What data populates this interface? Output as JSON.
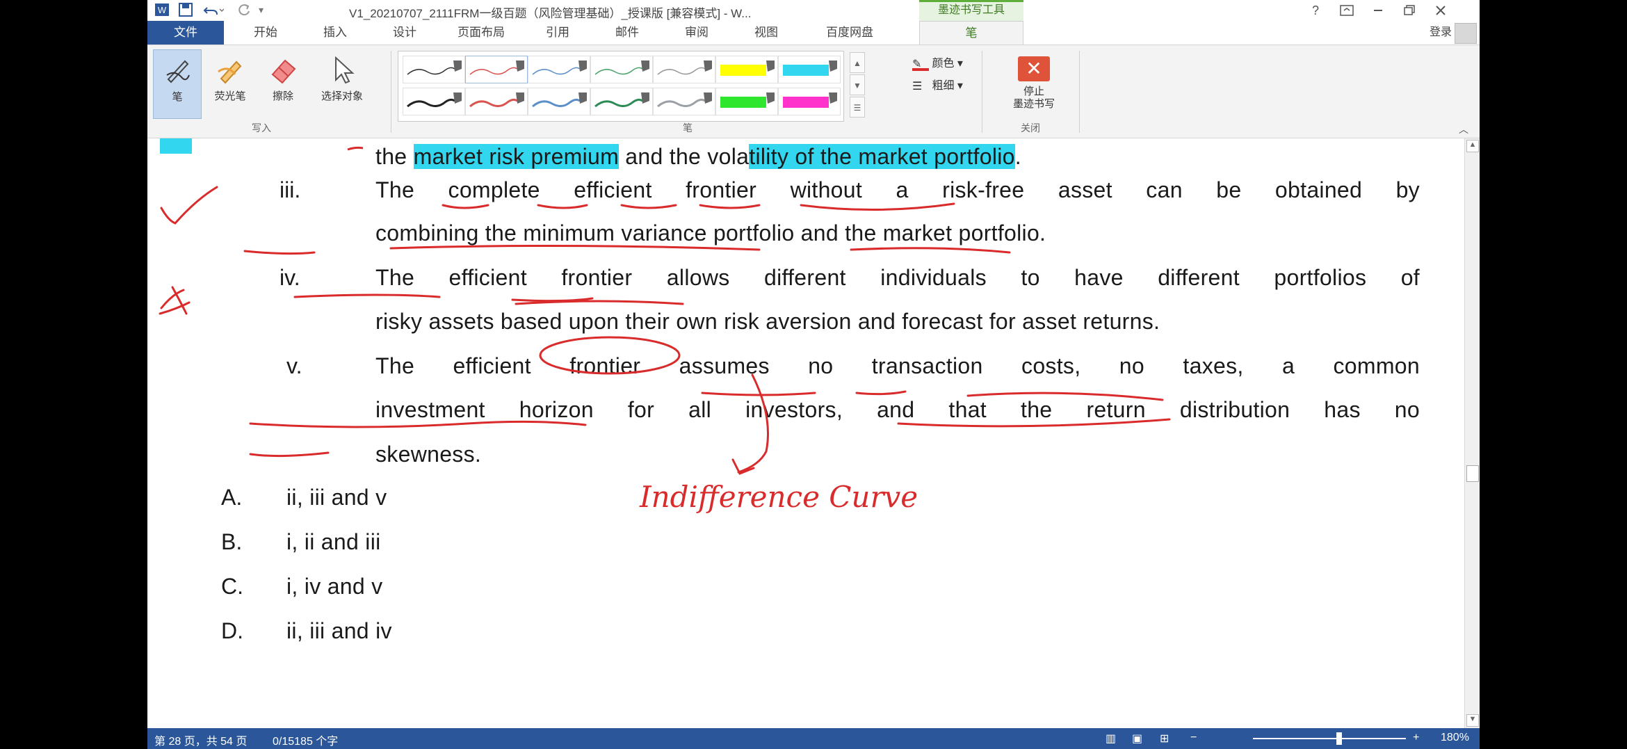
{
  "window": {
    "title": "V1_20210707_2111FRM一级百题（风险管理基础）_授课版 [兼容模式] - W...",
    "context_tab": "墨迹书写工具",
    "help": "?",
    "login": "登录"
  },
  "tabs": [
    "文件",
    "开始",
    "插入",
    "设计",
    "页面布局",
    "引用",
    "邮件",
    "审阅",
    "视图",
    "百度网盘",
    "笔"
  ],
  "ribbon": {
    "write_group": {
      "buttons": [
        "笔",
        "荧光笔",
        "擦除",
        "选择对象"
      ],
      "label": "写入"
    },
    "pens_label": "笔",
    "color_label": "颜色",
    "weight_label": "粗细",
    "stop_button": "停止\n墨迹书写",
    "stop_line1": "停止",
    "stop_line2": "墨迹书写",
    "close_label": "关闭",
    "pen_colors": [
      "#333333",
      "#d9534f",
      "#5a8fc9",
      "#4aa36b",
      "#999999",
      "#ffff00",
      "#33d6ef",
      "#222222",
      "#d9534f",
      "#5a8fc9",
      "#2e8b57",
      "#9aa0a6",
      "#2ee62e",
      "#ff33cc"
    ]
  },
  "doc": {
    "line0": {
      "a": "the ",
      "b": "market risk premium",
      "c": " and the vola",
      "d": "tility of the market portfolio",
      "e": "."
    },
    "item3": {
      "num": "iii.",
      "l1": "The complete efficient frontier without a risk-free asset can be obtained by",
      "l2": "combining the minimum variance portfolio and the market portfolio."
    },
    "item4": {
      "num": "iv.",
      "l1": "The efficient frontier allows different individuals to have different portfolios of",
      "l2": "risky assets based upon their own risk aversion and forecast for asset returns."
    },
    "item5": {
      "num": "v.",
      "l1": "The efficient frontier assumes no transaction costs, no taxes, a common",
      "l2": "investment horizon for all investors, and that the return distribution has no",
      "l3": "skewness."
    },
    "options": [
      {
        "letter": "A.",
        "text": "ii, iii and v"
      },
      {
        "letter": "B.",
        "text": "i, ii and iii"
      },
      {
        "letter": "C.",
        "text": "i, iv and v"
      },
      {
        "letter": "D.",
        "text": "ii, iii and iv"
      }
    ],
    "handwriting": "Indifference Curve"
  },
  "status": {
    "page": "第 28 页，共 54 页",
    "words": "0/15185 个字",
    "zoom": "180%"
  },
  "colors": {
    "accent": "#2b579a",
    "highlight": "#33d6ef",
    "ink_red": "#d92b2b"
  }
}
